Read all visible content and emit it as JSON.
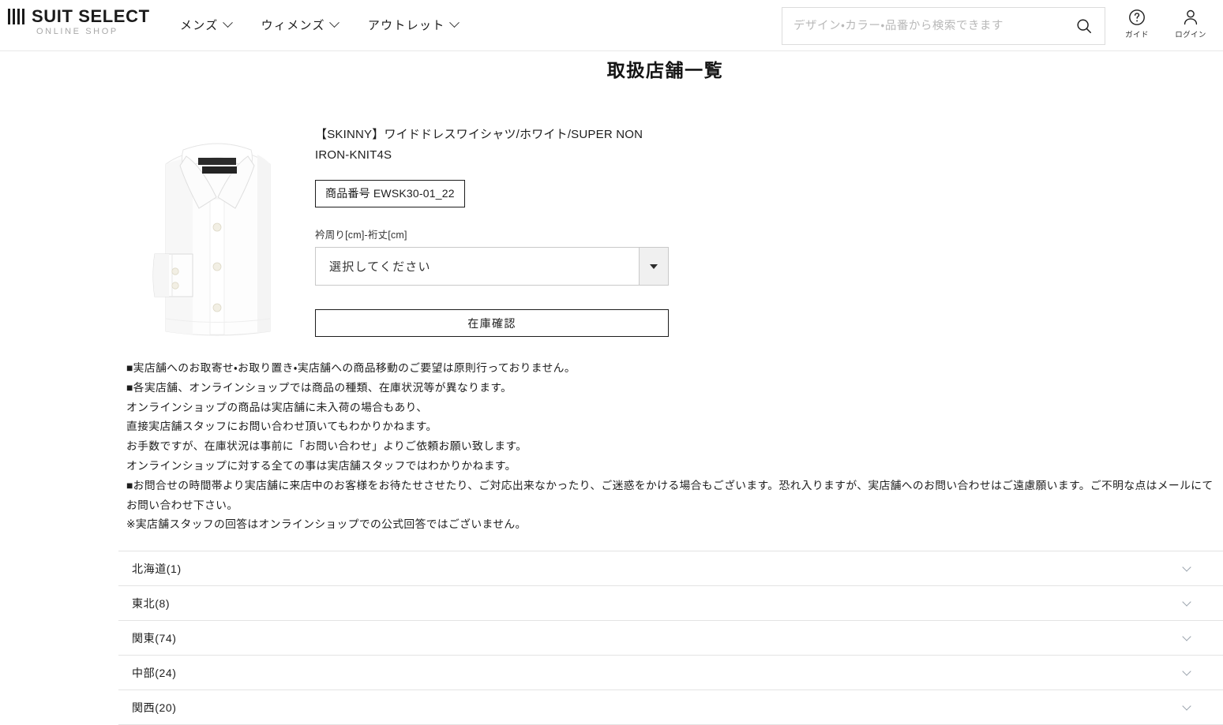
{
  "header": {
    "logo": {
      "name": "SUIT SELECT",
      "sub": "ONLINE SHOP"
    },
    "nav": [
      {
        "label": "メンズ",
        "icon": "chevron-down-icon"
      },
      {
        "label": "ウィメンズ",
        "icon": "chevron-down-icon"
      },
      {
        "label": "アウトレット",
        "icon": "chevron-down-icon"
      }
    ],
    "search": {
      "placeholder": "デザイン・カラー・品番から検索できます",
      "value": "",
      "icon": "search-icon"
    },
    "icons": [
      {
        "icon": "question-circle-icon",
        "label": "ガイド"
      },
      {
        "icon": "user-icon",
        "label": "ログイン"
      }
    ]
  },
  "page": {
    "title": "取扱店舗一覧"
  },
  "product": {
    "image_alt": "white-dress-shirt",
    "title": "【SKINNY】ワイドドレスワイシャツ/ホワイト/SUPER NON IRON-KNIT4S",
    "code": "商品番号 EWSK30-01_22",
    "size_label": "衿周り[cm]-裄丈[cm]",
    "size_select_value": "選択してください",
    "stock_button": "在庫確認"
  },
  "notice": {
    "lines": [
      "■実店舗へのお取寄せ・お取り置き・実店舗への商品移動のご要望は原則行っておりません。",
      "■各実店舗、オンラインショップでは商品の種類、在庫状況等が異なります。",
      "オンラインショップの商品は実店舗に未入荷の場合もあり、",
      "直接実店舗スタッフにお問い合わせ頂いてもわかりかねます。",
      "お手数ですが、在庫状況は事前に「お問い合わせ」よりご依頼お願い致します。",
      "オンラインショップに対する全ての事は実店舗スタッフではわかりかねます。",
      "■お問合せの時間帯より実店舗に来店中のお客様をお待たせさせたり、ご対応出来なかったり、ご迷惑をかける場合もございます。恐れ入りますが、実店舗へのお問い合わせはご遠慮願います。ご不明な点はメールにてお問い合わせ下さい。",
      "※実店舗スタッフの回答はオンラインショップでの公式回答ではございません。"
    ]
  },
  "regions": [
    {
      "label": "北海道(1)",
      "icon": "chevron-down-icon"
    },
    {
      "label": "東北(8)",
      "icon": "chevron-down-icon"
    },
    {
      "label": "関東(74)",
      "icon": "chevron-down-icon"
    },
    {
      "label": "中部(24)",
      "icon": "chevron-down-icon"
    },
    {
      "label": "関西(20)",
      "icon": "chevron-down-icon"
    }
  ],
  "colors": {
    "text": "#1d1d1d",
    "muted": "#a8a8a8",
    "border": "#e3e3e3",
    "chevron": "#9aa3ad",
    "select_button_bg": "#f0f0f0"
  }
}
